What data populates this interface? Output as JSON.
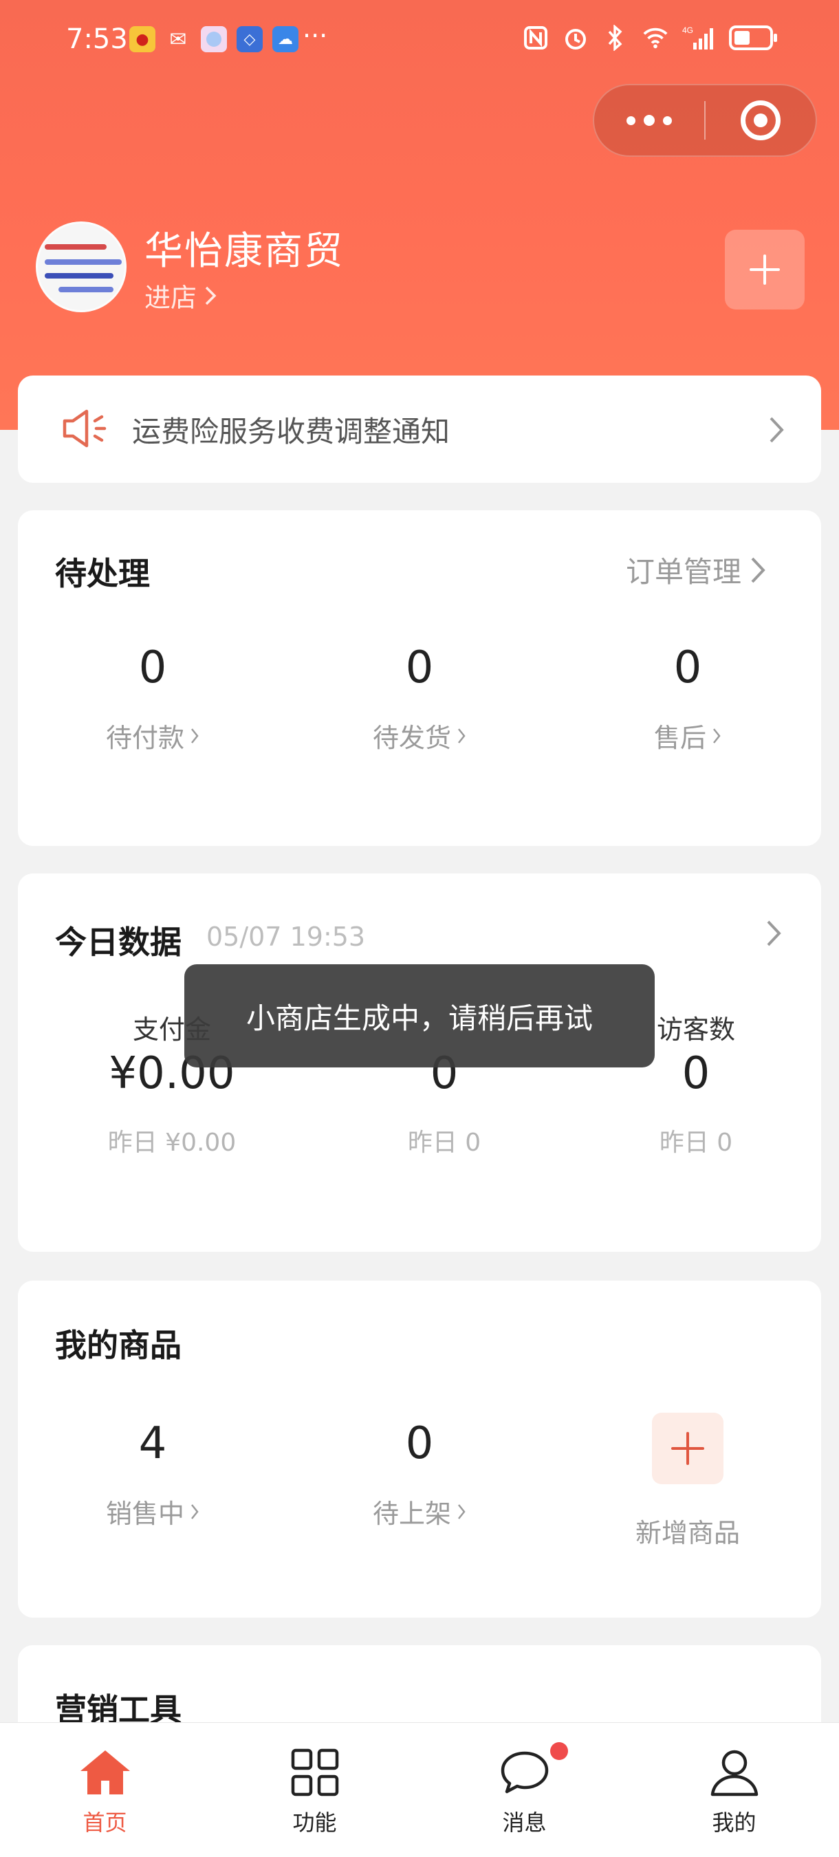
{
  "status_bar": {
    "time": "7:53",
    "more": "···",
    "apps": [
      "weibo-icon",
      "wechat-icon",
      "photos-icon",
      "files-icon",
      "cloud-icon"
    ],
    "network": "4G"
  },
  "shop": {
    "name": "华怡康商贸",
    "enter_label": "进店"
  },
  "notice": {
    "text": "运费险服务收费调整通知"
  },
  "pending": {
    "title": "待处理",
    "link": "订单管理",
    "items": [
      {
        "value": "0",
        "label": "待付款"
      },
      {
        "value": "0",
        "label": "待发货"
      },
      {
        "value": "0",
        "label": "售后"
      }
    ]
  },
  "today": {
    "title": "今日数据",
    "timestamp": "05/07 19:53",
    "items": [
      {
        "label": "支付金",
        "value": "¥0.00",
        "yesterday": "昨日 ¥0.00"
      },
      {
        "label": "",
        "value": "0",
        "yesterday": "昨日 0"
      },
      {
        "label": "访客数",
        "value": "0",
        "yesterday": "昨日 0"
      }
    ]
  },
  "goods": {
    "title": "我的商品",
    "items": [
      {
        "value": "4",
        "label": "销售中"
      },
      {
        "value": "0",
        "label": "待上架"
      }
    ],
    "add_label": "新增商品"
  },
  "marketing": {
    "title": "营销工具"
  },
  "toast": {
    "text": "小商店生成中，请稍后再试"
  },
  "tabbar": {
    "items": [
      {
        "label": "首页",
        "icon": "home-icon"
      },
      {
        "label": "功能",
        "icon": "grid-icon"
      },
      {
        "label": "消息",
        "icon": "message-icon"
      },
      {
        "label": "我的",
        "icon": "profile-icon"
      }
    ]
  },
  "colors": {
    "brand": "#ff6f55",
    "accent": "#ee5a43",
    "badge": "#ef4b4b"
  }
}
